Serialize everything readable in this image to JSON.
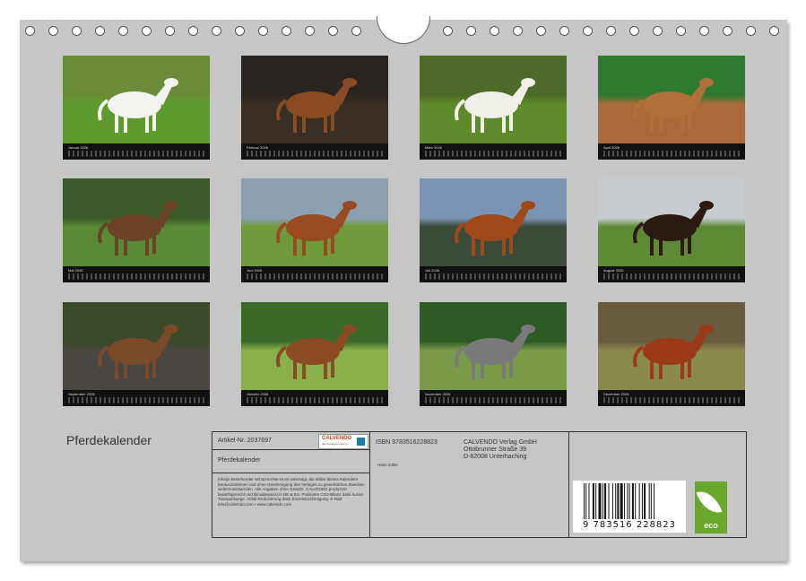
{
  "calendar_title": "Pferdekalender",
  "months": [
    {
      "label": "Januar 2026"
    },
    {
      "label": "Februar 2026"
    },
    {
      "label": "März 2026"
    },
    {
      "label": "April 2026"
    },
    {
      "label": "Mai 2026"
    },
    {
      "label": "Juni 2026"
    },
    {
      "label": "Juli 2026"
    },
    {
      "label": "August 2026"
    },
    {
      "label": "September 2026"
    },
    {
      "label": "Oktober 2026"
    },
    {
      "label": "November 2026"
    },
    {
      "label": "Dezember 2026"
    }
  ],
  "info": {
    "article": "Artikel-Nr. 2037697",
    "logo_text": "CALVENDO",
    "logo_sub": "das Verlagsprogramm",
    "product_title": "Pferdekalender",
    "legal_text": "Infolge bestehender Schutzrechte ist es untersagt, die Bilder dieses Kalenders herauszutrennen und ohne Genehmigung des Verlages zu gewerblichen Zwecken weiterzuverwenden. Alle Angaben ohne Gewähr. CALVENDO produziert bedarfsgerecht und klimabewusst in DE & EU. Positivere CO2-Bilanz dank kurzer Transportwege. Abfall-Reduzierung dank Einzelstückfertigung. E-Mail: info@calvendo.com • www.calvendo.com",
    "isbn": "ISBN 9783516228823",
    "publisher_name": "CALVENDO Verlag GmbH",
    "publisher_street": "Ottobrunner Straße 39",
    "publisher_city": "D-82008 Unterhaching",
    "author": "Hans Zöller",
    "barcode_number": "9 783516 228823",
    "eco_label": "eco"
  }
}
